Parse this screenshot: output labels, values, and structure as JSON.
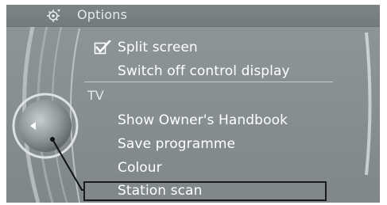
{
  "header": {
    "title": "Options",
    "icon": "options-gear-icon"
  },
  "menu": {
    "items": [
      {
        "label": "Split screen",
        "checked": true
      },
      {
        "label": "Switch off control display"
      }
    ],
    "section_label": "TV",
    "section_items": [
      {
        "label": "Show Owner's Handbook"
      },
      {
        "label": "Save programme"
      },
      {
        "label": "Colour"
      },
      {
        "label": "Station scan",
        "highlighted": true
      }
    ]
  },
  "controls": {
    "knob_icon": "back-arrow-icon",
    "scrollbar_icon": "scrollbar-icon"
  },
  "colors": {
    "screen_bg": "#878f93",
    "text": "#ffffff",
    "highlight_border": "#1a1a1a"
  }
}
